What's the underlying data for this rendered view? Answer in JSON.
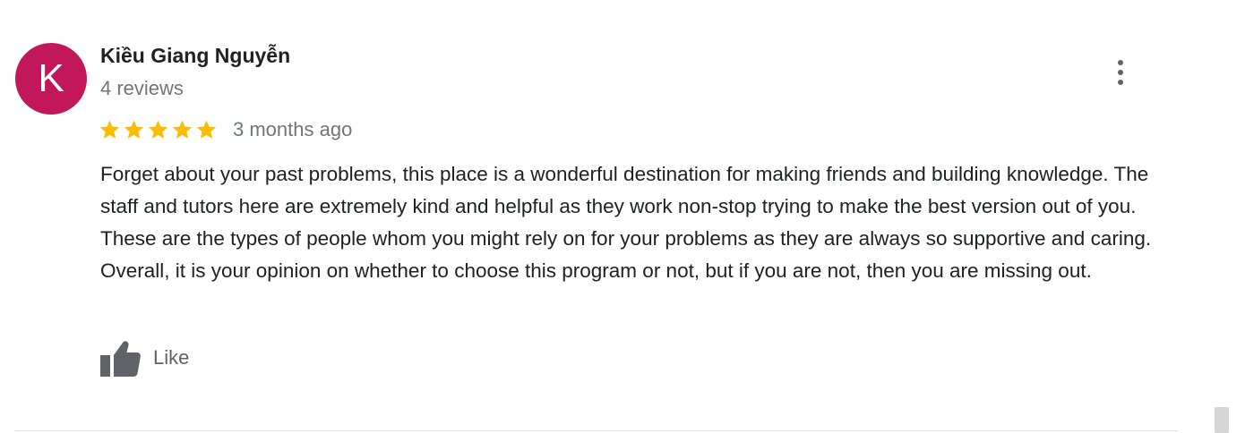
{
  "review": {
    "avatar_letter": "K",
    "avatar_color": "#c2185b",
    "author_name": "Kiều Giang Nguyễn",
    "review_count": "4 reviews",
    "rating": 5,
    "rating_max": 5,
    "star_color": "#fbbc04",
    "date": "3 months ago",
    "text": "Forget about your past problems, this place is a wonderful destination for making friends and building knowledge. The staff and tutors here are extremely kind and helpful as they work non-stop trying to make the best version out of you. These are the types of people whom you might rely on for your problems as they are always so supportive and caring. Overall, it is your opinion on whether to choose this program or not, but if you are not, then you are missing out.",
    "like_label": "Like",
    "more_icon": "more-vert-icon",
    "like_icon": "thumbs-up-icon",
    "star_icon": "star-icon"
  }
}
